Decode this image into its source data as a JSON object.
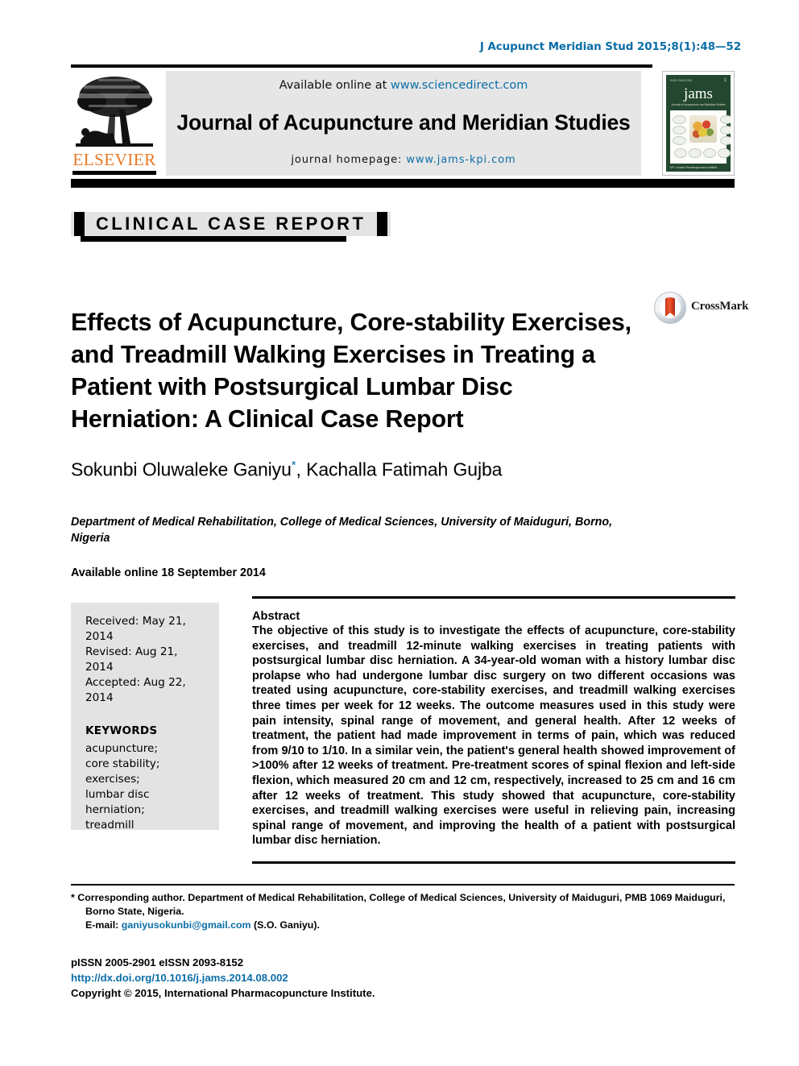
{
  "running_head": "J Acupunct Meridian Stud 2015;8(1):48—52",
  "masthead": {
    "available_prefix": "Available online at ",
    "available_url": "www.sciencedirect.com",
    "journal_name": "Journal of Acupuncture and Meridian Studies",
    "homepage_prefix": "journal homepage: ",
    "homepage_url": "www.jams-kpi.com",
    "publisher_logo_text": "ELSEVIER",
    "cover": {
      "title": "jams",
      "subtitle": "Journal of Acupuncture and Meridian Studies",
      "top_left": "ISSN 2005-2901",
      "top_right": "1",
      "bottom_text": "KPI / Korean Pharmacopuncture Institute"
    }
  },
  "section_banner": "CLINICAL CASE REPORT",
  "article": {
    "title": "Effects of Acupuncture, Core-stability Exercises, and Treadmill Walking Exercises in Treating a Patient with Postsurgical Lumbar Disc Herniation: A Clinical Case Report",
    "crossmark_label": "CrossMark",
    "authors": "Sokunbi Oluwaleke Ganiyu",
    "author_marker": "*",
    "authors_rest": ", Kachalla Fatimah Gujba",
    "affiliation": "Department of Medical Rehabilitation, College of Medical Sciences, University of Maiduguri, Borno, Nigeria",
    "available_online": "Available online 18 September 2014"
  },
  "sidebar": {
    "received": "Received: May 21, 2014",
    "revised": "Revised: Aug 21, 2014",
    "accepted": "Accepted: Aug 22, 2014",
    "keywords_heading": "KEYWORDS",
    "keywords": "acupuncture;\ncore stability;\nexercises;\nlumbar disc herniation;\ntreadmill"
  },
  "abstract": {
    "heading": "Abstract",
    "body": "The objective of this study is to investigate the effects of acupuncture, core-stability exercises, and treadmill 12-minute walking exercises in treating patients with postsurgical lumbar disc herniation. A 34-year-old woman with a history lumbar disc prolapse who had undergone lumbar disc surgery on two different occasions was treated using acupuncture, core-stability exercises, and treadmill walking exercises three times per week for 12 weeks. The outcome measures used in this study were pain intensity, spinal range of movement, and general health. After 12 weeks of treatment, the patient had made improvement in terms of pain, which was reduced from 9/10 to 1/10. In a similar vein, the patient's general health showed improvement of >100% after 12 weeks of treatment. Pre-treatment scores of spinal flexion and left-side flexion, which measured 20 cm and 12 cm, respectively, increased to 25 cm and 16 cm after 12 weeks of treatment. This study showed that acupuncture, core-stability exercises, and treadmill walking exercises were useful in relieving pain, increasing spinal range of movement, and improving the health of a patient with postsurgical lumbar disc herniation."
  },
  "footnote": {
    "corresponding_line1": "* Corresponding author. Department of Medical Rehabilitation, College of Medical Sciences, University of Maiduguri, PMB 1069 Maiduguri,",
    "corresponding_line2": "Borno State, Nigeria.",
    "email_label": "E-mail: ",
    "email": "ganiyusokunbi@gmail.com",
    "email_suffix": " (S.O. Ganiyu)."
  },
  "issn_block": {
    "issn_line": "pISSN 2005-2901    eISSN 2093-8152",
    "doi": "http://dx.doi.org/10.1016/j.jams.2014.08.002",
    "copyright": "Copyright © 2015, International Pharmacopuncture Institute."
  },
  "colors": {
    "link": "#0b6ea8",
    "elsevier_orange": "#E87722",
    "masthead_gray": "#e6e6e6",
    "sidebar_gray": "#e3e3e3",
    "cover_green": "#23482f",
    "crossmark_red": "#d8401f"
  }
}
